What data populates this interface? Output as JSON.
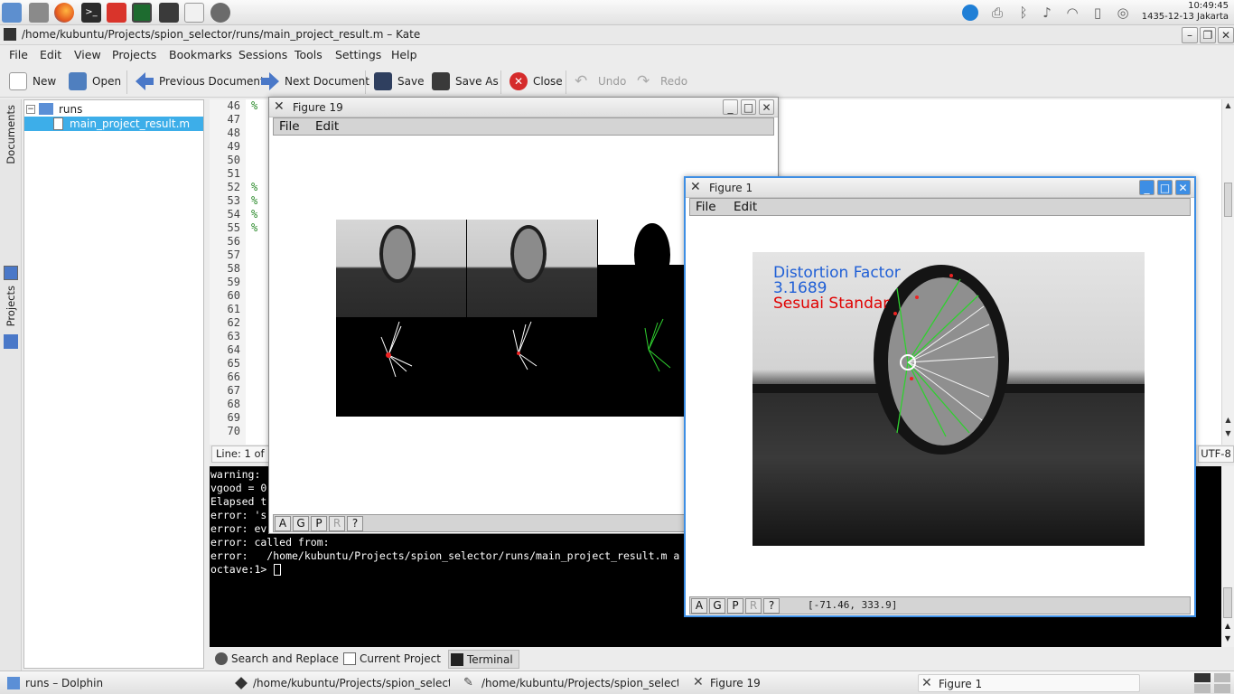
{
  "clock": {
    "time": "10:49:45",
    "date": "1435-12-13 Jakarta"
  },
  "kate": {
    "title": "/home/kubuntu/Projects/spion_selector/runs/main_project_result.m – Kate",
    "menu": [
      "File",
      "Edit",
      "View",
      "Projects",
      "Bookmarks",
      "Sessions",
      "Tools",
      "Settings",
      "Help"
    ],
    "toolbar": {
      "new": "New",
      "open": "Open",
      "previous_document": "Previous Document",
      "next_document": "Next Document",
      "save": "Save",
      "save_as": "Save As",
      "close": "Close",
      "undo": "Undo",
      "redo": "Redo"
    },
    "side_tabs": {
      "documents": "Documents",
      "projects": "Projects"
    },
    "tree": {
      "folder": "runs",
      "file": "main_project_result.m"
    },
    "line_numbers": [
      "46",
      "47",
      "48",
      "49",
      "50",
      "51",
      "52",
      "53",
      "54",
      "55",
      "56",
      "57",
      "58",
      "59",
      "60",
      "61",
      "62",
      "63",
      "64",
      "65",
      "66",
      "67",
      "68",
      "69",
      "70"
    ],
    "comment_marks": {
      "46": "%",
      "52": "%",
      "53": "%",
      "54": "%",
      "55": "%"
    },
    "status": {
      "line_col": "Line: 1 of 2",
      "encoding": "UTF-8"
    },
    "terminal_lines": [
      "warning:",
      "vgood = 0",
      "Elapsed t",
      "error: 's",
      "error: ev",
      "error: called from:",
      "error:   /home/kubuntu/Projects/spion_selector/runs/main_project_result.m a",
      "octave:1> "
    ],
    "tool_tabs": {
      "search": "Search and Replace",
      "project": "Current Project",
      "terminal": "Terminal"
    }
  },
  "figure19": {
    "title": "Figure 19",
    "menu": {
      "file": "File",
      "edit": "Edit"
    },
    "tools": [
      "A",
      "G",
      "P",
      "R",
      "?"
    ]
  },
  "figure1": {
    "title": "Figure 1",
    "menu": {
      "file": "File",
      "edit": "Edit"
    },
    "tools": [
      "A",
      "G",
      "P",
      "R",
      "?"
    ],
    "coords": "[-71.46, 333.9]",
    "overlay": {
      "label": "Distortion Factor",
      "value": "3.1689",
      "verdict": "Sesuai Standar",
      "label_color": "#1f5fd6",
      "verdict_color": "#e00000"
    }
  },
  "taskbar": {
    "dolphin": "runs – Dolphin",
    "kate1": "/home/kubuntu/Projects/spion_select",
    "kate2": "/home/kubuntu/Projects/spion_select",
    "fig19": "Figure 19",
    "fig1": "Figure 1"
  }
}
